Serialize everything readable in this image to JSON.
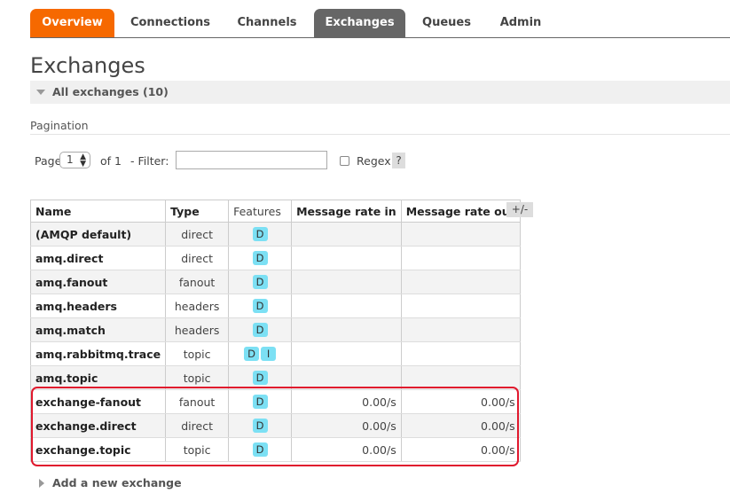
{
  "tabs": [
    {
      "label": "Overview",
      "state": "orange"
    },
    {
      "label": "Connections",
      "state": ""
    },
    {
      "label": "Channels",
      "state": ""
    },
    {
      "label": "Exchanges",
      "state": "active"
    },
    {
      "label": "Queues",
      "state": ""
    },
    {
      "label": "Admin",
      "state": ""
    }
  ],
  "page_title": "Exchanges",
  "section_label": "All exchanges (10)",
  "pagination": {
    "heading": "Pagination",
    "page_label": "Page",
    "page_value": "1",
    "of_label": "of 1",
    "filter_label": "- Filter:",
    "filter_value": "",
    "regex_label": "Regex",
    "help_label": "?"
  },
  "table": {
    "columns": [
      "Name",
      "Type",
      "Features",
      "Message rate in",
      "Message rate out"
    ],
    "toggle_label": "+/-",
    "rows": [
      {
        "name": "(AMQP default)",
        "type": "direct",
        "features": [
          "D"
        ],
        "rate_in": "",
        "rate_out": ""
      },
      {
        "name": "amq.direct",
        "type": "direct",
        "features": [
          "D"
        ],
        "rate_in": "",
        "rate_out": ""
      },
      {
        "name": "amq.fanout",
        "type": "fanout",
        "features": [
          "D"
        ],
        "rate_in": "",
        "rate_out": ""
      },
      {
        "name": "amq.headers",
        "type": "headers",
        "features": [
          "D"
        ],
        "rate_in": "",
        "rate_out": ""
      },
      {
        "name": "amq.match",
        "type": "headers",
        "features": [
          "D"
        ],
        "rate_in": "",
        "rate_out": ""
      },
      {
        "name": "amq.rabbitmq.trace",
        "type": "topic",
        "features": [
          "D",
          "I"
        ],
        "rate_in": "",
        "rate_out": ""
      },
      {
        "name": "amq.topic",
        "type": "topic",
        "features": [
          "D"
        ],
        "rate_in": "",
        "rate_out": ""
      },
      {
        "name": "exchange-fanout",
        "type": "fanout",
        "features": [
          "D"
        ],
        "rate_in": "0.00/s",
        "rate_out": "0.00/s"
      },
      {
        "name": "exchange.direct",
        "type": "direct",
        "features": [
          "D"
        ],
        "rate_in": "0.00/s",
        "rate_out": "0.00/s"
      },
      {
        "name": "exchange.topic",
        "type": "topic",
        "features": [
          "D"
        ],
        "rate_in": "0.00/s",
        "rate_out": "0.00/s"
      }
    ]
  },
  "add_new_label": "Add a new exchange",
  "colors": {
    "orange_tab": "#f66900",
    "active_tab": "#666666",
    "badge": "#7ce0f4",
    "highlight": "#e0182d"
  }
}
